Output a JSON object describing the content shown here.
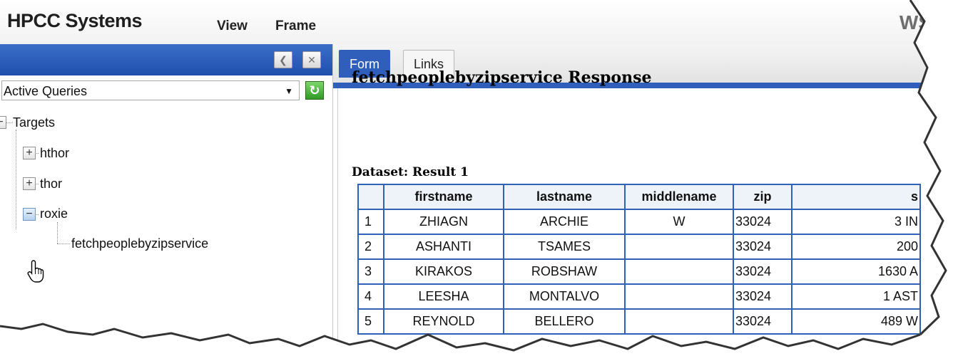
{
  "header": {
    "brand": "HPCC Systems",
    "menu": [
      "View",
      "Frame"
    ],
    "title_partial": "WS"
  },
  "left_panel": {
    "query_select": {
      "value": "Active Queries"
    },
    "tree": {
      "root": "Targets",
      "children": [
        "hthor",
        "thor",
        "roxie"
      ],
      "roxie_child": "fetchpeoplebyzipservice"
    }
  },
  "tabs": [
    "Form",
    "Links"
  ],
  "response": {
    "title": "fetchpeoplebyzipservice Response",
    "dataset_label": "Dataset: Result 1",
    "columns": [
      "",
      "firstname",
      "lastname",
      "middlename",
      "zip",
      "s"
    ],
    "rows": [
      [
        "1",
        "ZHIAGN",
        "ARCHIE",
        "W",
        "33024",
        "3 IN"
      ],
      [
        "2",
        "ASHANTI",
        "TSAMES",
        "",
        "33024",
        "200"
      ],
      [
        "3",
        "KIRAKOS",
        "ROBSHAW",
        "",
        "33024",
        "1630 A"
      ],
      [
        "4",
        "LEESHA",
        "MONTALVO",
        "",
        "33024",
        "1 AST"
      ],
      [
        "5",
        "REYNOLD",
        "BELLERO",
        "",
        "33024",
        "489 W"
      ]
    ]
  },
  "colors": {
    "accent": "#2f5fba",
    "panel_header": "#2a5bbb",
    "refresh": "#3aa22c"
  }
}
